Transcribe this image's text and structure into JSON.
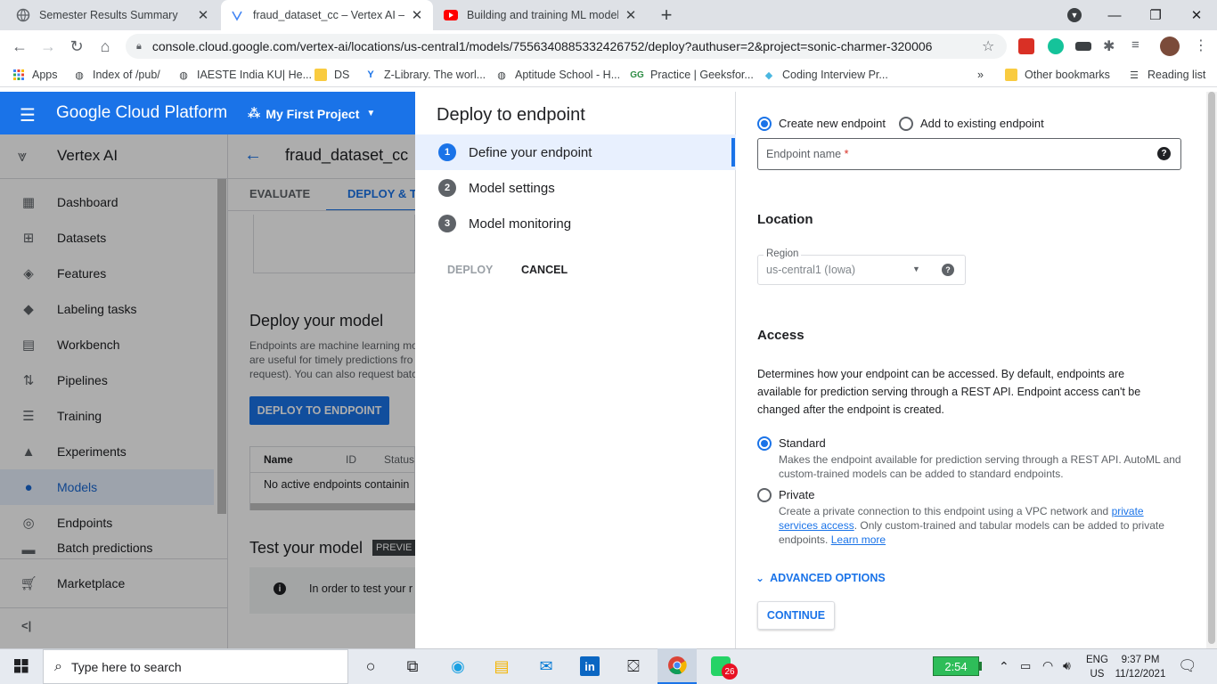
{
  "browser": {
    "tabs": [
      {
        "title": "Semester Results Summary",
        "icon": "globe-icon"
      },
      {
        "title": "fraud_dataset_cc – Vertex AI – My",
        "icon": "vertex-icon"
      },
      {
        "title": "Building and training ML models",
        "icon": "youtube-icon"
      }
    ],
    "new_tab": "+",
    "url": "console.cloud.google.com/vertex-ai/locations/us-central1/models/7556340885332426752/deploy?authuser=2&project=sonic-charmer-320006",
    "bookmarks": [
      {
        "label": "Apps",
        "icon": "apps-grid-icon"
      },
      {
        "label": "Index of /pub/",
        "icon": "globe-icon"
      },
      {
        "label": "IAESTE India KU| He...",
        "icon": "globe-icon"
      },
      {
        "label": "DS",
        "icon": "folder-icon"
      },
      {
        "label": "Z-Library. The worl...",
        "icon": "zlib-icon"
      },
      {
        "label": "Aptitude School - H...",
        "icon": "globe-icon"
      },
      {
        "label": "Practice | Geeksfor...",
        "icon": "gfg-icon"
      },
      {
        "label": "Coding Interview Pr...",
        "icon": "stack-icon"
      }
    ],
    "more_bookmarks": "»",
    "other_bookmarks": "Other bookmarks",
    "reading_list": "Reading list"
  },
  "gcp": {
    "platform": "Google Cloud Platform",
    "project": "My First Project",
    "product": "Vertex AI",
    "nav": [
      {
        "label": "Dashboard",
        "icon": "dashboard-icon"
      },
      {
        "label": "Datasets",
        "icon": "datasets-icon"
      },
      {
        "label": "Features",
        "icon": "features-icon"
      },
      {
        "label": "Labeling tasks",
        "icon": "label-icon"
      },
      {
        "label": "Workbench",
        "icon": "workbench-icon"
      },
      {
        "label": "Pipelines",
        "icon": "pipelines-icon"
      },
      {
        "label": "Training",
        "icon": "training-icon"
      },
      {
        "label": "Experiments",
        "icon": "experiments-icon"
      },
      {
        "label": "Models",
        "icon": "models-icon"
      },
      {
        "label": "Endpoints",
        "icon": "endpoints-icon"
      },
      {
        "label": "Batch predictions",
        "icon": "batch-icon"
      }
    ],
    "marketplace": "Marketplace",
    "collapse": "<|"
  },
  "main": {
    "model_title": "fraud_dataset_cc",
    "tabs": [
      "EVALUATE",
      "DEPLOY & TE"
    ],
    "deploy_heading": "Deploy your model",
    "deploy_desc": [
      "Endpoints are machine learning mo",
      "are useful for timely predictions fro",
      "request). You can also request batc"
    ],
    "deploy_button": "DEPLOY TO ENDPOINT",
    "table_headers": [
      "Name",
      "ID",
      "Status"
    ],
    "table_empty": "No active endpoints containin",
    "test_heading": "Test your model",
    "preview_badge": "PREVIE",
    "test_info": "In order to test your r"
  },
  "panel": {
    "title": "Deploy to endpoint",
    "steps": [
      {
        "num": "1",
        "label": "Define your endpoint"
      },
      {
        "num": "2",
        "label": "Model settings"
      },
      {
        "num": "3",
        "label": "Model monitoring"
      }
    ],
    "deploy": "DEPLOY",
    "cancel": "CANCEL",
    "endpoint_choice": {
      "create": "Create new endpoint",
      "existing": "Add to existing endpoint"
    },
    "endpoint_name": {
      "placeholder": "Endpoint name",
      "required_mark": "*"
    },
    "location_heading": "Location",
    "region_label": "Region",
    "region_value": "us-central1 (Iowa)",
    "access_heading": "Access",
    "access_desc": [
      "Determines how your endpoint can be accessed. By default, endpoints are",
      "available for prediction serving through a REST API. Endpoint access can't be",
      "changed after the endpoint is created."
    ],
    "standard": {
      "label": "Standard",
      "desc": [
        "Makes the endpoint available for prediction serving through a REST API. AutoML and",
        "custom-trained models can be added to standard endpoints."
      ]
    },
    "private": {
      "label": "Private",
      "desc_a": "Create a private connection to this endpoint using a VPC network and ",
      "link_a": "private",
      "link_b": "services access",
      "desc_b": ". Only custom-trained and tabular models can be added to private",
      "desc_c": "endpoints. ",
      "learn_more": "Learn more"
    },
    "advanced": "ADVANCED OPTIONS",
    "continue": "CONTINUE"
  },
  "taskbar": {
    "search_placeholder": "Type here to search",
    "battery": "2:54",
    "lang": "ENG",
    "region": "US",
    "time": "9:37 PM",
    "date": "11/12/2021",
    "badge": "26"
  },
  "colors": {
    "accent": "#1a73e8",
    "gcp_blue": "#1a73e8",
    "required": "#d93025"
  }
}
